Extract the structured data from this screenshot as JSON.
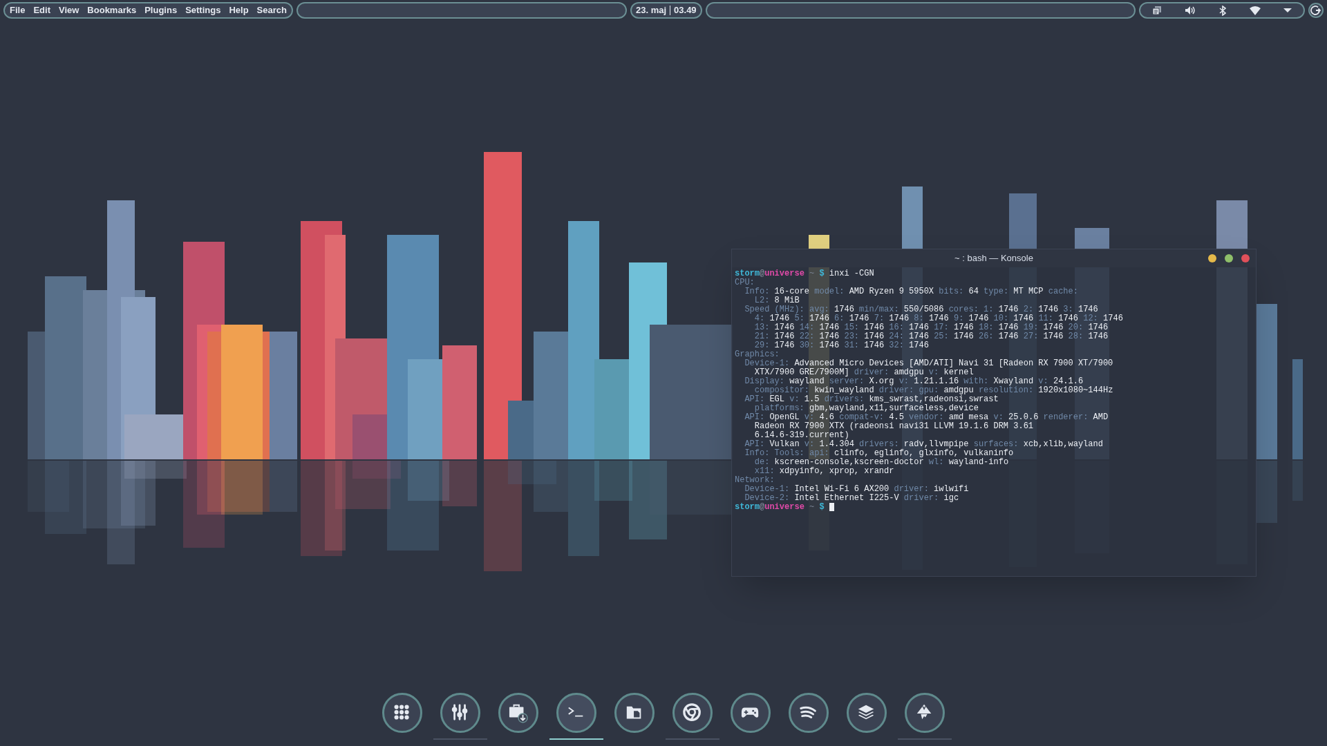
{
  "menu_bar": {
    "items": [
      "File",
      "Edit",
      "View",
      "Bookmarks",
      "Plugins",
      "Settings",
      "Help",
      "Search"
    ]
  },
  "clock": {
    "date": "23. maj",
    "time": "03.49"
  },
  "terminal": {
    "title": "~ : bash — Konsole",
    "lines": [
      {
        "cursor": false,
        "spans": [
          {
            "kind": "user",
            "text": "storm"
          },
          {
            "kind": "at",
            "text": "@"
          },
          {
            "kind": "host",
            "text": "universe"
          },
          {
            "kind": "dim",
            "text": " ~ "
          },
          {
            "kind": "prompt",
            "text": "$ "
          },
          {
            "kind": "value",
            "text": "inxi -CGN"
          }
        ]
      },
      {
        "cursor": false,
        "spans": [
          {
            "kind": "key",
            "text": "CPU:"
          }
        ]
      },
      {
        "cursor": false,
        "spans": [
          {
            "kind": "key",
            "text": "  Info:"
          },
          {
            "kind": "value",
            "text": " 16-core "
          },
          {
            "kind": "key",
            "text": "model:"
          },
          {
            "kind": "value",
            "text": " AMD Ryzen 9 5950X "
          },
          {
            "kind": "key",
            "text": "bits:"
          },
          {
            "kind": "value",
            "text": " 64 "
          },
          {
            "kind": "key",
            "text": "type:"
          },
          {
            "kind": "value",
            "text": " MT MCP "
          },
          {
            "kind": "key",
            "text": "cache:"
          }
        ]
      },
      {
        "cursor": false,
        "spans": [
          {
            "kind": "key",
            "text": "    L2:"
          },
          {
            "kind": "value",
            "text": " 8 MiB"
          }
        ]
      },
      {
        "cursor": false,
        "spans": [
          {
            "kind": "key",
            "text": "  Speed (MHz): avg:"
          },
          {
            "kind": "value",
            "text": " 1746 "
          },
          {
            "kind": "key",
            "text": "min/max:"
          },
          {
            "kind": "value",
            "text": " 550/5086 "
          },
          {
            "kind": "key",
            "text": "cores: 1:"
          },
          {
            "kind": "value",
            "text": " 1746 "
          },
          {
            "kind": "key",
            "text": "2:"
          },
          {
            "kind": "value",
            "text": " 1746 "
          },
          {
            "kind": "key",
            "text": "3:"
          },
          {
            "kind": "value",
            "text": " 1746"
          }
        ]
      },
      {
        "cursor": false,
        "spans": [
          {
            "kind": "key",
            "text": "    4:"
          },
          {
            "kind": "value",
            "text": " 1746 "
          },
          {
            "kind": "key",
            "text": "5:"
          },
          {
            "kind": "value",
            "text": " 1746 "
          },
          {
            "kind": "key",
            "text": "6:"
          },
          {
            "kind": "value",
            "text": " 1746 "
          },
          {
            "kind": "key",
            "text": "7:"
          },
          {
            "kind": "value",
            "text": " 1746 "
          },
          {
            "kind": "key",
            "text": "8:"
          },
          {
            "kind": "value",
            "text": " 1746 "
          },
          {
            "kind": "key",
            "text": "9:"
          },
          {
            "kind": "value",
            "text": " 1746 "
          },
          {
            "kind": "key",
            "text": "10:"
          },
          {
            "kind": "value",
            "text": " 1746 "
          },
          {
            "kind": "key",
            "text": "11:"
          },
          {
            "kind": "value",
            "text": " 1746 "
          },
          {
            "kind": "key",
            "text": "12:"
          },
          {
            "kind": "value",
            "text": " 1746"
          }
        ]
      },
      {
        "cursor": false,
        "spans": [
          {
            "kind": "key",
            "text": "    13:"
          },
          {
            "kind": "value",
            "text": " 1746 "
          },
          {
            "kind": "key",
            "text": "14:"
          },
          {
            "kind": "value",
            "text": " 1746 "
          },
          {
            "kind": "key",
            "text": "15:"
          },
          {
            "kind": "value",
            "text": " 1746 "
          },
          {
            "kind": "key",
            "text": "16:"
          },
          {
            "kind": "value",
            "text": " 1746 "
          },
          {
            "kind": "key",
            "text": "17:"
          },
          {
            "kind": "value",
            "text": " 1746 "
          },
          {
            "kind": "key",
            "text": "18:"
          },
          {
            "kind": "value",
            "text": " 1746 "
          },
          {
            "kind": "key",
            "text": "19:"
          },
          {
            "kind": "value",
            "text": " 1746 "
          },
          {
            "kind": "key",
            "text": "20:"
          },
          {
            "kind": "value",
            "text": " 1746"
          }
        ]
      },
      {
        "cursor": false,
        "spans": [
          {
            "kind": "key",
            "text": "    21:"
          },
          {
            "kind": "value",
            "text": " 1746 "
          },
          {
            "kind": "key",
            "text": "22:"
          },
          {
            "kind": "value",
            "text": " 1746 "
          },
          {
            "kind": "key",
            "text": "23:"
          },
          {
            "kind": "value",
            "text": " 1746 "
          },
          {
            "kind": "key",
            "text": "24:"
          },
          {
            "kind": "value",
            "text": " 1746 "
          },
          {
            "kind": "key",
            "text": "25:"
          },
          {
            "kind": "value",
            "text": " 1746 "
          },
          {
            "kind": "key",
            "text": "26:"
          },
          {
            "kind": "value",
            "text": " 1746 "
          },
          {
            "kind": "key",
            "text": "27:"
          },
          {
            "kind": "value",
            "text": " 1746 "
          },
          {
            "kind": "key",
            "text": "28:"
          },
          {
            "kind": "value",
            "text": " 1746"
          }
        ]
      },
      {
        "cursor": false,
        "spans": [
          {
            "kind": "key",
            "text": "    29:"
          },
          {
            "kind": "value",
            "text": " 1746 "
          },
          {
            "kind": "key",
            "text": "30:"
          },
          {
            "kind": "value",
            "text": " 1746 "
          },
          {
            "kind": "key",
            "text": "31:"
          },
          {
            "kind": "value",
            "text": " 1746 "
          },
          {
            "kind": "key",
            "text": "32:"
          },
          {
            "kind": "value",
            "text": " 1746"
          }
        ]
      },
      {
        "cursor": false,
        "spans": [
          {
            "kind": "key",
            "text": "Graphics:"
          }
        ]
      },
      {
        "cursor": false,
        "spans": [
          {
            "kind": "key",
            "text": "  Device-1:"
          },
          {
            "kind": "value",
            "text": " Advanced Micro Devices [AMD/ATI] Navi 31 [Radeon RX 7900 XT/7900"
          }
        ]
      },
      {
        "cursor": false,
        "spans": [
          {
            "kind": "value",
            "text": "    XTX/7900 GRE/7900M] "
          },
          {
            "kind": "key",
            "text": "driver:"
          },
          {
            "kind": "value",
            "text": " amdgpu "
          },
          {
            "kind": "key",
            "text": "v:"
          },
          {
            "kind": "value",
            "text": " kernel"
          }
        ]
      },
      {
        "cursor": false,
        "spans": [
          {
            "kind": "key",
            "text": "  Display:"
          },
          {
            "kind": "value",
            "text": " wayland "
          },
          {
            "kind": "key",
            "text": "server:"
          },
          {
            "kind": "value",
            "text": " X.org "
          },
          {
            "kind": "key",
            "text": "v:"
          },
          {
            "kind": "value",
            "text": " 1.21.1.16 "
          },
          {
            "kind": "key",
            "text": "with:"
          },
          {
            "kind": "value",
            "text": " Xwayland "
          },
          {
            "kind": "key",
            "text": "v:"
          },
          {
            "kind": "value",
            "text": " 24.1.6"
          }
        ]
      },
      {
        "cursor": false,
        "spans": [
          {
            "kind": "key",
            "text": "    compositor:"
          },
          {
            "kind": "value",
            "text": " kwin_wayland "
          },
          {
            "kind": "key",
            "text": "driver: gpu:"
          },
          {
            "kind": "value",
            "text": " amdgpu "
          },
          {
            "kind": "key",
            "text": "resolution:"
          },
          {
            "kind": "value",
            "text": " 1920x1080~144Hz"
          }
        ]
      },
      {
        "cursor": false,
        "spans": [
          {
            "kind": "key",
            "text": "  API:"
          },
          {
            "kind": "value",
            "text": " EGL "
          },
          {
            "kind": "key",
            "text": "v:"
          },
          {
            "kind": "value",
            "text": " 1.5 "
          },
          {
            "kind": "key",
            "text": "drivers:"
          },
          {
            "kind": "value",
            "text": " kms_swrast,radeonsi,swrast"
          }
        ]
      },
      {
        "cursor": false,
        "spans": [
          {
            "kind": "key",
            "text": "    platforms:"
          },
          {
            "kind": "value",
            "text": " gbm,wayland,x11,surfaceless,device"
          }
        ]
      },
      {
        "cursor": false,
        "spans": [
          {
            "kind": "key",
            "text": "  API:"
          },
          {
            "kind": "value",
            "text": " OpenGL "
          },
          {
            "kind": "key",
            "text": "v:"
          },
          {
            "kind": "value",
            "text": " 4.6 "
          },
          {
            "kind": "key",
            "text": "compat-v:"
          },
          {
            "kind": "value",
            "text": " 4.5 "
          },
          {
            "kind": "key",
            "text": "vendor:"
          },
          {
            "kind": "value",
            "text": " amd mesa "
          },
          {
            "kind": "key",
            "text": "v:"
          },
          {
            "kind": "value",
            "text": " 25.0.6 "
          },
          {
            "kind": "key",
            "text": "renderer:"
          },
          {
            "kind": "value",
            "text": " AMD"
          }
        ]
      },
      {
        "cursor": false,
        "spans": [
          {
            "kind": "value",
            "text": "    Radeon RX 7900 XTX (radeonsi navi31 LLVM 19.1.6 DRM 3.61"
          }
        ]
      },
      {
        "cursor": false,
        "spans": [
          {
            "kind": "value",
            "text": "    6.14.6-319.current)"
          }
        ]
      },
      {
        "cursor": false,
        "spans": [
          {
            "kind": "key",
            "text": "  API:"
          },
          {
            "kind": "value",
            "text": " Vulkan "
          },
          {
            "kind": "key",
            "text": "v:"
          },
          {
            "kind": "value",
            "text": " 1.4.304 "
          },
          {
            "kind": "key",
            "text": "drivers:"
          },
          {
            "kind": "value",
            "text": " radv,llvmpipe "
          },
          {
            "kind": "key",
            "text": "surfaces:"
          },
          {
            "kind": "value",
            "text": " xcb,xlib,wayland"
          }
        ]
      },
      {
        "cursor": false,
        "spans": [
          {
            "kind": "key",
            "text": "  Info: Tools: api:"
          },
          {
            "kind": "value",
            "text": " clinfo, eglinfo, glxinfo, vulkaninfo"
          }
        ]
      },
      {
        "cursor": false,
        "spans": [
          {
            "kind": "key",
            "text": "    de:"
          },
          {
            "kind": "value",
            "text": " kscreen-console,kscreen-doctor "
          },
          {
            "kind": "key",
            "text": "wl:"
          },
          {
            "kind": "value",
            "text": " wayland-info"
          }
        ]
      },
      {
        "cursor": false,
        "spans": [
          {
            "kind": "key",
            "text": "    x11:"
          },
          {
            "kind": "value",
            "text": " xdpyinfo, xprop, xrandr"
          }
        ]
      },
      {
        "cursor": false,
        "spans": [
          {
            "kind": "key",
            "text": "Network:"
          }
        ]
      },
      {
        "cursor": false,
        "spans": [
          {
            "kind": "key",
            "text": "  Device-1:"
          },
          {
            "kind": "value",
            "text": " Intel Wi-Fi 6 AX200 "
          },
          {
            "kind": "key",
            "text": "driver:"
          },
          {
            "kind": "value",
            "text": " iwlwifi"
          }
        ]
      },
      {
        "cursor": false,
        "spans": [
          {
            "kind": "key",
            "text": "  Device-2:"
          },
          {
            "kind": "value",
            "text": " Intel Ethernet I225-V "
          },
          {
            "kind": "key",
            "text": "driver:"
          },
          {
            "kind": "value",
            "text": " igc"
          }
        ]
      },
      {
        "cursor": true,
        "spans": [
          {
            "kind": "user",
            "text": "storm"
          },
          {
            "kind": "at",
            "text": "@"
          },
          {
            "kind": "host",
            "text": "universe"
          },
          {
            "kind": "dim",
            "text": " ~ "
          },
          {
            "kind": "prompt",
            "text": "$ "
          }
        ]
      }
    ]
  },
  "dock": [
    {
      "kind": "grid",
      "running": false,
      "active": false
    },
    {
      "kind": "sliders",
      "running": true,
      "active": false
    },
    {
      "kind": "store",
      "running": false,
      "active": false
    },
    {
      "kind": "terminal",
      "running": true,
      "active": true
    },
    {
      "kind": "folder",
      "running": false,
      "active": false
    },
    {
      "kind": "browser",
      "running": true,
      "active": false
    },
    {
      "kind": "gamepad",
      "running": false,
      "active": false
    },
    {
      "kind": "music",
      "running": false,
      "active": false
    },
    {
      "kind": "layers",
      "running": false,
      "active": false
    },
    {
      "kind": "vector",
      "running": true,
      "active": false
    }
  ]
}
